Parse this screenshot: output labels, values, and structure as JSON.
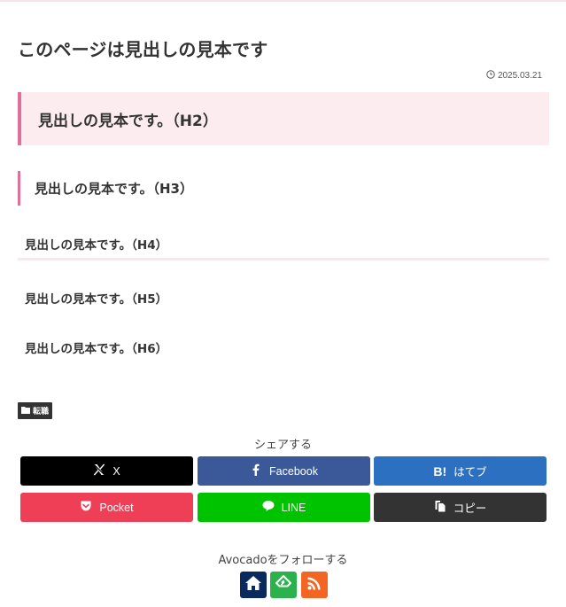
{
  "page": {
    "title": "このページは見出しの見本です",
    "date": "2025.03.21"
  },
  "headings": {
    "h2": "見出しの見本です。（H2）",
    "h3": "見出しの見本です。（H3）",
    "h4": "見出しの見本です。（H4）",
    "h5": "見出しの見本です。（H5）",
    "h6": "見出しの見本です。（H6）"
  },
  "category": {
    "label": "転職",
    "icon": "folder-icon"
  },
  "share": {
    "title": "シェアする",
    "buttons": [
      {
        "label": "X",
        "icon": "x-logo-icon",
        "color": "#000000"
      },
      {
        "label": "Facebook",
        "icon": "facebook-icon",
        "color": "#3b5998"
      },
      {
        "label": "はてブ",
        "icon": "hatena-bookmark-icon",
        "color": "#2c70c2"
      },
      {
        "label": "Pocket",
        "icon": "pocket-icon",
        "color": "#ef3f56"
      },
      {
        "label": "LINE",
        "icon": "line-icon",
        "color": "#00c300"
      },
      {
        "label": "コピー",
        "icon": "copy-icon",
        "color": "#333333"
      }
    ],
    "hatena_mark": "B!"
  },
  "follow": {
    "title": "Avocadoをフォローする",
    "buttons": [
      {
        "icon": "home-icon",
        "color": "#0a2a5e"
      },
      {
        "icon": "feedly-icon",
        "color": "#2bb24c"
      },
      {
        "icon": "rss-icon",
        "color": "#f26522"
      }
    ]
  },
  "colors": {
    "accent_pink": "#e0709a",
    "heading_bg": "#fdecef"
  }
}
